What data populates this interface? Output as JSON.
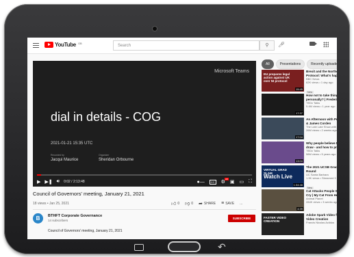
{
  "topbar": {
    "brand": "YouTube",
    "brand_sup": "GB",
    "search_placeholder": "Search"
  },
  "player": {
    "slide_brand": "Microsoft Teams",
    "slide_title": "dial in details - COG",
    "slide_date": "2021-01-21 15:35 UTC",
    "presenter_label": "Recorded by",
    "presenter_name": "Jacqui Maurice",
    "organizer_label": "Organizer",
    "organizer_name": "Sheridan Orbourne",
    "time": "0:02 / 2:13:48",
    "progress": 0.02,
    "progress_color": "#ff0000"
  },
  "video": {
    "title": "Council of Governors' meeting, January 21, 2021",
    "meta": "18 views • Jan 25, 2021",
    "likes": "0",
    "dislikes": "0",
    "share": "SHARE",
    "save": "SAVE",
    "more": "..."
  },
  "channel": {
    "avatar_letter": "B",
    "name": "BTHFT Corporate Governance",
    "subs": "14 subscribers",
    "subscribe": "SUBSCRIBE",
    "description": "Council of Governors' meeting, January 21, 2021"
  },
  "chips": [
    "All",
    "Presentations",
    "Recently uploaded"
  ],
  "recommendations": [
    {
      "title": "Brexit and the Northern",
      "title2": "Protocol: What's happe",
      "channel": "BBC News",
      "meta": "62K views • 1 day ago",
      "badge": "New",
      "duration": "15:45",
      "thumb_text": "EU prepares legal action against UK over NI protocol",
      "thumb_color": "#7a1f1f"
    },
    {
      "title": "How not to take things",
      "title2": "personally? | Frederik I",
      "channel": "TEDx Talks",
      "meta": "5.4M views • 1 year ago",
      "badge": "",
      "duration": "17:37",
      "thumb_text": "",
      "thumb_color": "#1a1a1a"
    },
    {
      "title": "An Afternoon with Prin",
      "title2": "& James Corden",
      "channel": "The Late Late Show with",
      "meta": "26M views • 2 weeks ago",
      "badge": "",
      "duration": "17:04",
      "thumb_text": "",
      "thumb_color": "#3b4a5a"
    },
    {
      "title": "Why people believe the",
      "title2": "draw - and how to prov",
      "channel": "TEDx Talks",
      "meta": "58M views • 5 years ago",
      "badge": "",
      "duration": "13:04",
      "thumb_text": "",
      "thumb_color": "#6a4b8c"
    },
    {
      "title": "The 2021 UCSB Grad S",
      "title2": "Round",
      "channel": "UC Santa Barbara",
      "meta": "1.9K views • Streamed 3",
      "badge": "New",
      "duration": "1:34:48",
      "thumb_text": "VIRTUAL GRAD SLAM",
      "thumb_big": "Watch Live",
      "thumb_color": "#0d2a5c"
    },
    {
      "title": "Cat Attacks People Wh",
      "title2": "Cry | My Cat From Hell",
      "channel": "Animal Planet",
      "meta": "284K views • 3 weeks ago",
      "badge": "",
      "duration": "4:39",
      "thumb_text": "",
      "thumb_color": "#5a5040"
    },
    {
      "title": "Adobe Spark Video for",
      "title2": "Video Creation",
      "channel": "Francis Nicolas Aclidus",
      "meta": "",
      "badge": "",
      "duration": "",
      "thumb_text": "FASTER VIDEO CREATION",
      "thumb_color": "#222222"
    }
  ]
}
